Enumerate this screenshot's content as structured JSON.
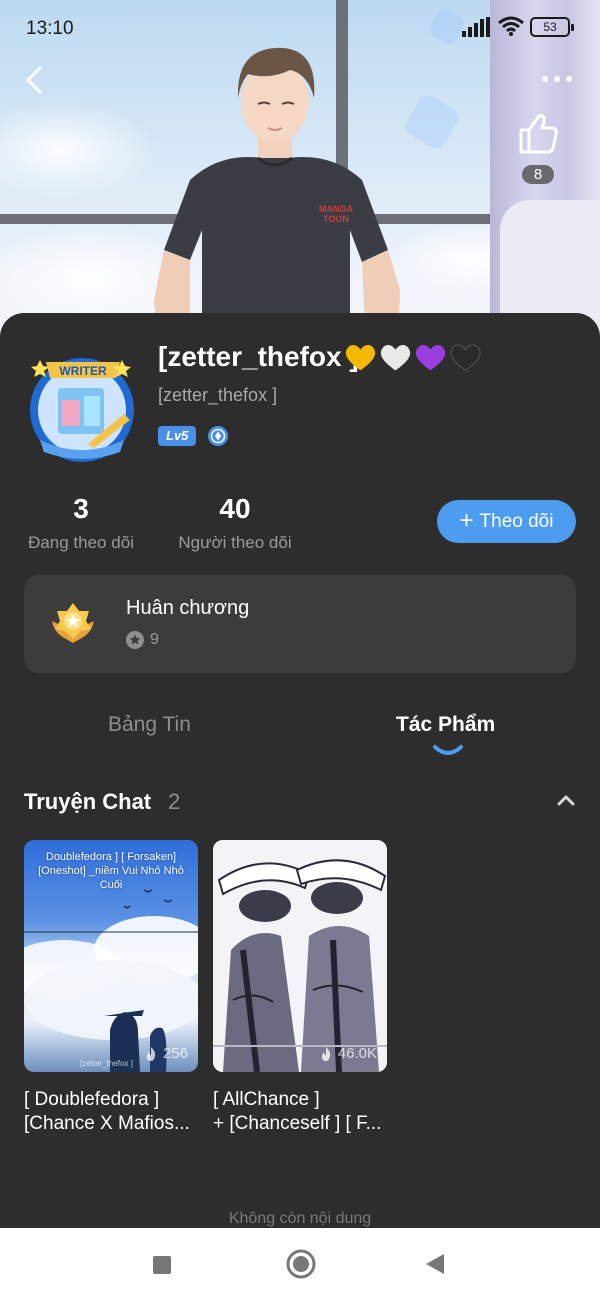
{
  "status_bar": {
    "time": "13:10",
    "battery": "53"
  },
  "header": {
    "like_count": "8"
  },
  "profile": {
    "name": "[zetter_thefox ]",
    "handle": "[zetter_thefox ]",
    "level_badge": "Lv5",
    "name_hearts": [
      "#f5b800",
      "#e9e9e9",
      "#9b3ee0",
      "#2a2a2a"
    ]
  },
  "stats": {
    "following": {
      "value": "3",
      "label": "Đang theo dõi"
    },
    "followers": {
      "value": "40",
      "label": "Người theo dõi"
    }
  },
  "follow_button": {
    "label": "Theo dõi"
  },
  "medals": {
    "title": "Huân chương",
    "count": "9"
  },
  "tabs": [
    {
      "label": "Bảng Tin",
      "active": false
    },
    {
      "label": "Tác Phẩm",
      "active": true
    }
  ],
  "section": {
    "title": "Truyện Chat",
    "count": "2"
  },
  "stories": [
    {
      "cover_caption": "Doublefedora ] [ Forsaken] [Oneshot] _niềm Vui Nhỏ Nhỏ Cuối",
      "cover_watermark": "[zetter_thefox ]",
      "views": "256",
      "title_line1": "[ Doublefedora ]",
      "title_line2": "[Chance X Mafios..."
    },
    {
      "views": "46.0K",
      "title_line1": "[ AllChance ]",
      "title_line2": "+ [Chanceself ] [ F..."
    }
  ],
  "end_text": "Không còn nội dung",
  "colors": {
    "accent": "#4c9cf0",
    "sheet": "#2d2d2d",
    "card": "#3c3c3c",
    "tab_indicator": "#4c9cf0"
  }
}
